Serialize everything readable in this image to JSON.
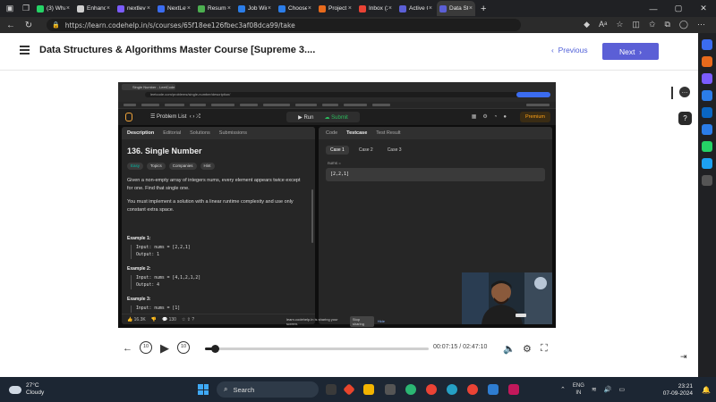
{
  "browser": {
    "tabs": [
      {
        "label": "(3) What",
        "color": "#25d366"
      },
      {
        "label": "Enhanc",
        "color": "#cfcfcf"
      },
      {
        "label": "nextlev",
        "color": "#7b5cff"
      },
      {
        "label": "NextLev",
        "color": "#3b6cf0"
      },
      {
        "label": "Resume",
        "color": "#4caf50"
      },
      {
        "label": "Job Wir",
        "color": "#2b7de9"
      },
      {
        "label": "Choose",
        "color": "#2b7de9"
      },
      {
        "label": "Project",
        "color": "#e86a1c"
      },
      {
        "label": "Inbox (2",
        "color": "#ea4335"
      },
      {
        "label": "Active C",
        "color": "#5b5fd6"
      },
      {
        "label": "Data Stru",
        "color": "#5b5fd6"
      }
    ],
    "url": "https://learn.codehelp.in/s/courses/65f18ee126fbec3af08dca99/take"
  },
  "header": {
    "course_title": "Data Structures & Algorithms Master Course [Supreme 3....",
    "previous_label": "Previous",
    "next_label": "Next"
  },
  "video": {
    "tab_title": "Single Number - LeetCode",
    "url": "leetcode.com/problems/single-number/description/",
    "problem_list_label": "Problem List",
    "run_label": "Run",
    "submit_label": "Submit",
    "premium_label": "Premium",
    "left_tabs": [
      "Description",
      "Editorial",
      "Solutions",
      "Submissions"
    ],
    "problem_title": "136. Single Number",
    "chips": [
      "Easy",
      "Topics",
      "Companies",
      "Hint"
    ],
    "desc1": "Given a non-empty array of integers nums, every element appears twice except for one. Find that single one.",
    "desc2": "You must implement a solution with a linear runtime complexity and use only constant extra space.",
    "example1_title": "Example 1:",
    "example1_body": [
      "Input: nums = [2,2,1]",
      "Output: 1"
    ],
    "example2_title": "Example 2:",
    "example2_body": [
      "Input: nums = [4,1,2,1,2]",
      "Output: 4"
    ],
    "example3_title": "Example 3:",
    "example3_body": [
      "Input: nums = [1]"
    ],
    "likes": "16.3K",
    "comments": "130",
    "right_tabs": [
      "Code",
      "Testcase",
      "Test Result"
    ],
    "cases": [
      "Case 1",
      "Case 2",
      "Case 3"
    ],
    "nums_label": "nums =",
    "nums_value": "[2,2,1]",
    "share_text": "learn.codehelp.in is sharing your screen.",
    "stop_label": "Stop sharing",
    "hide_label": "Hide"
  },
  "player": {
    "rewind_label": "10",
    "forward_label": "10",
    "current_time": "00:07:15",
    "separator": "/",
    "total_time": "02:47:10",
    "progress_fraction": 0.043
  },
  "taskbar": {
    "temperature": "27°C",
    "weather": "Cloudy",
    "search_label": "Search",
    "lang1": "ENG",
    "lang2": "IN",
    "time": "23:21",
    "date": "07-09-2024"
  }
}
